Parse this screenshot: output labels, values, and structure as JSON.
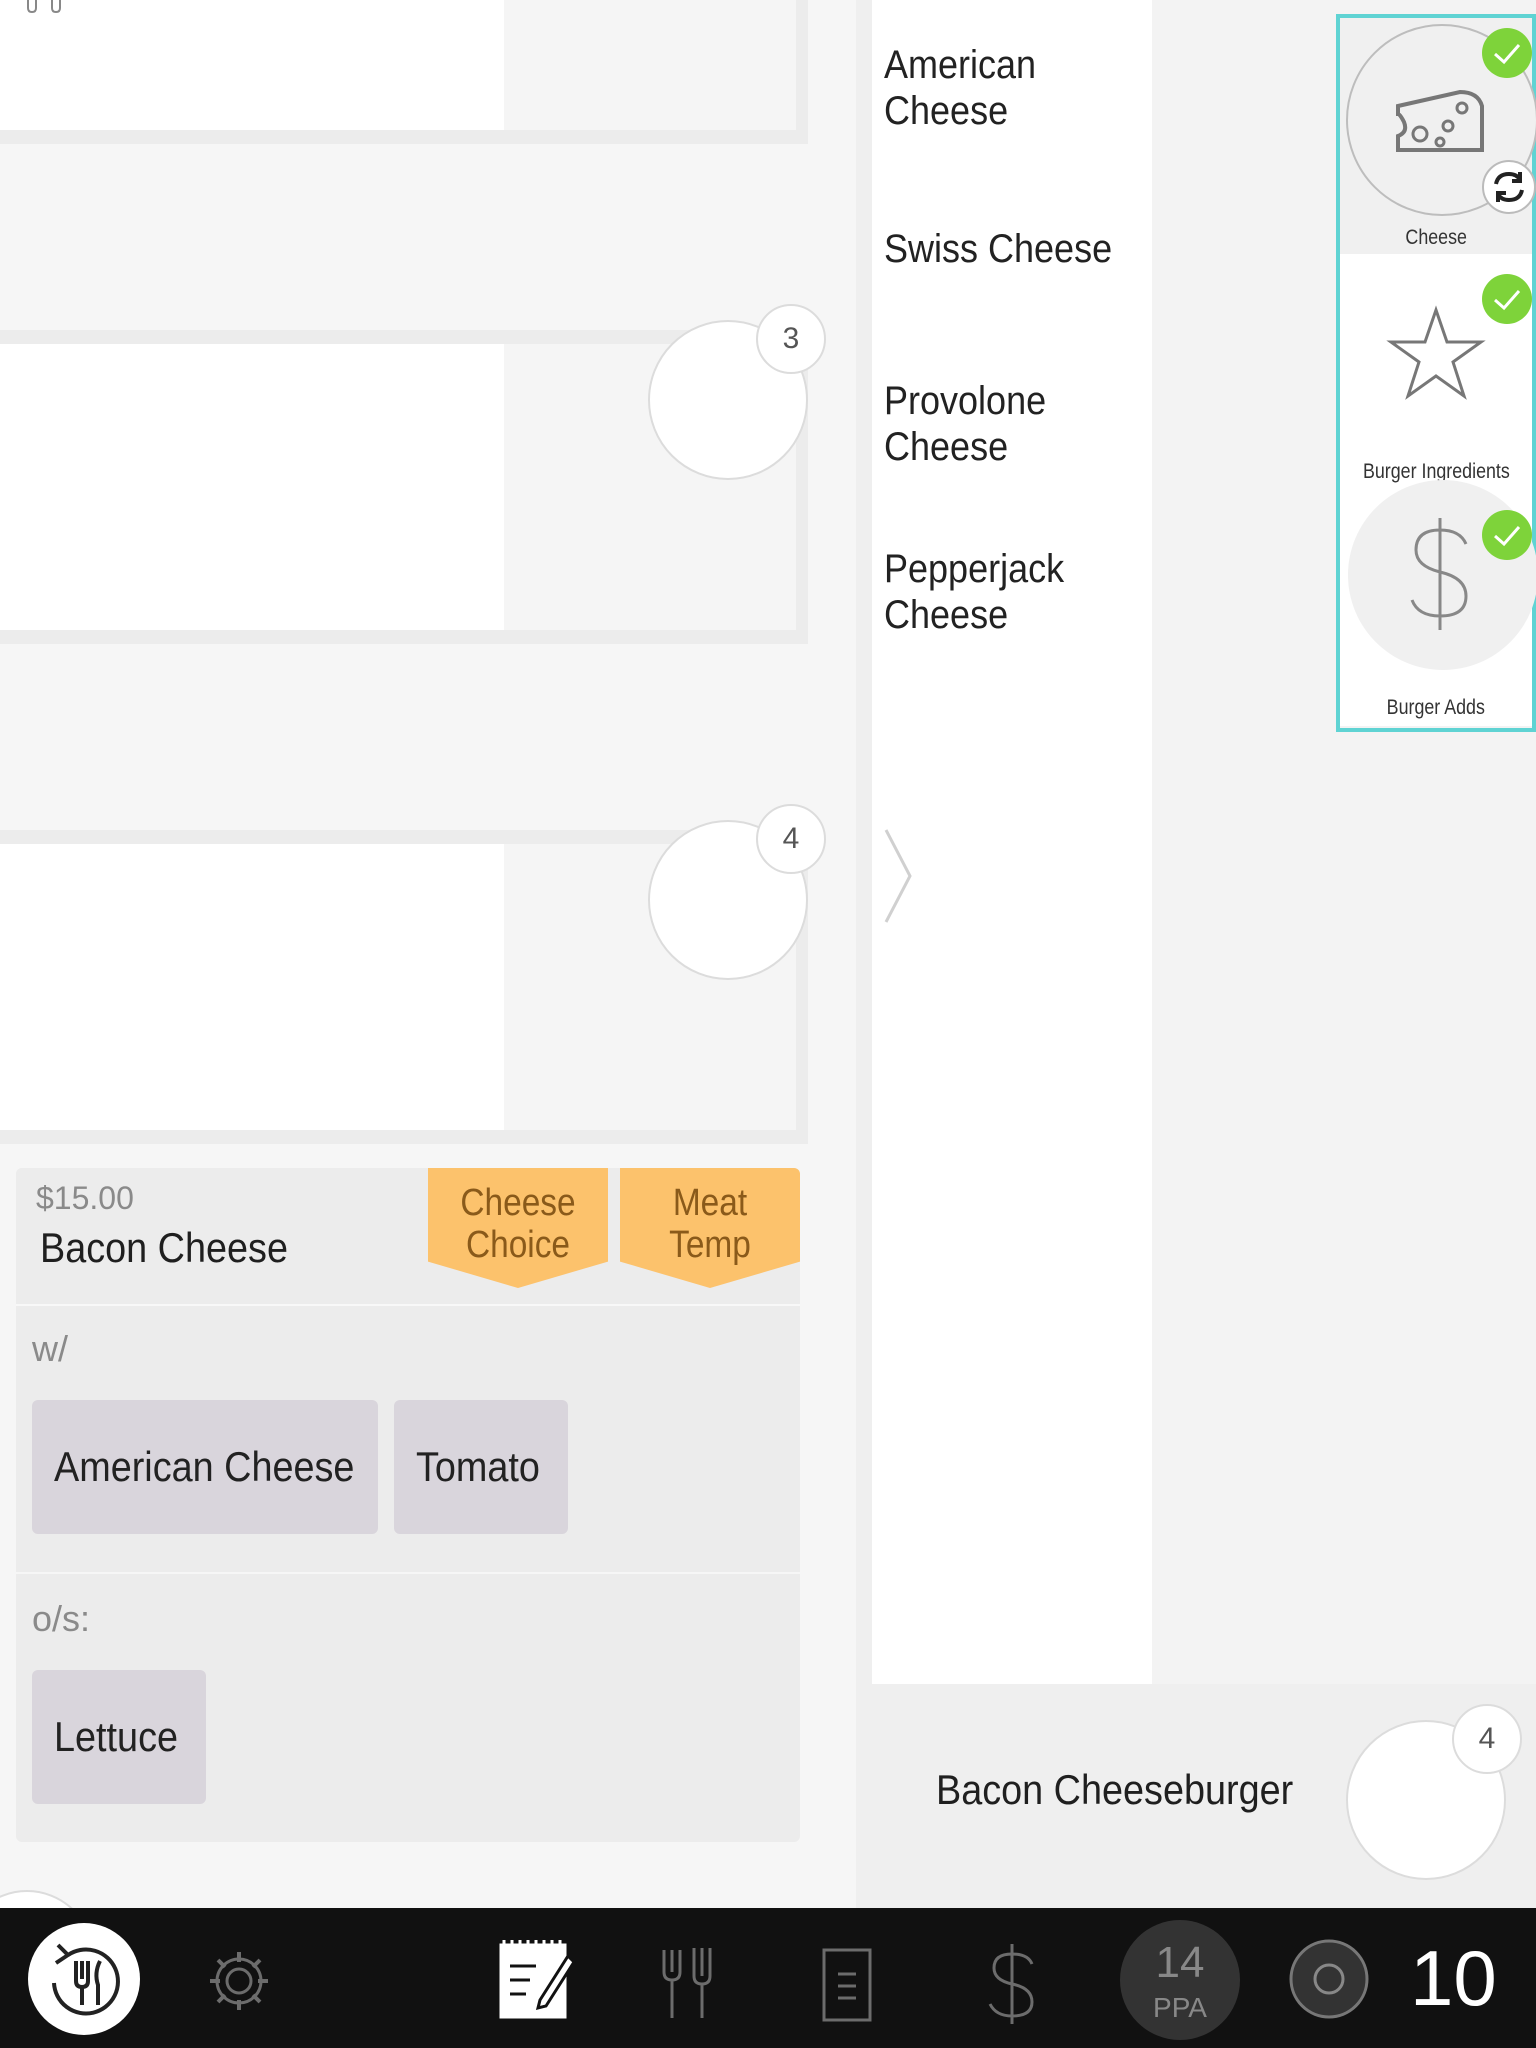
{
  "seats": {
    "badge_1": "3",
    "badge_2": "4"
  },
  "item_card": {
    "price": "$15.00",
    "name": "Bacon Cheese",
    "flags": [
      "Cheese Choice",
      "Meat Temp"
    ],
    "with_label": "w/",
    "with_items": [
      "American Cheese",
      "Tomato"
    ],
    "on_side_label": "o/s:",
    "on_side_items": [
      "Lettuce"
    ]
  },
  "menu_list": {
    "items": [
      "American Cheese",
      "Swiss Cheese",
      "Provolone Cheese",
      "Pepperjack Cheese"
    ]
  },
  "categories": [
    {
      "label": "Cheese",
      "icon": "cheese-icon",
      "checked": true,
      "selected": true
    },
    {
      "label": "Burger Ingredients",
      "icon": "star-icon",
      "checked": true,
      "selected": false
    },
    {
      "label": "Burger Adds",
      "icon": "dollar-icon",
      "checked": true,
      "selected": false
    }
  ],
  "current_item": {
    "name": "Bacon Cheeseburger",
    "seat": "4"
  },
  "toolbar": {
    "guest_count": "14",
    "guest_unit": "PPA",
    "table_number": "10"
  },
  "colors": {
    "accent_teal": "#5fd3d3",
    "flag_orange": "#fcc26c",
    "check_green": "#7ed33a",
    "chip": "#d9d5dc",
    "toolbar": "#111111"
  }
}
